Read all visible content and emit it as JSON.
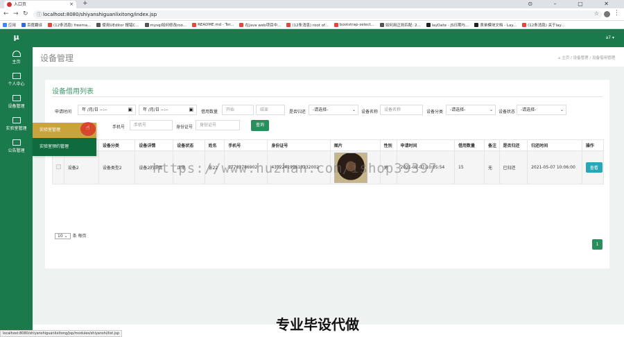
{
  "browser": {
    "tab_title": "入口页",
    "url": "localhost:8080/shiyanshiguanlixitong/index.jsp",
    "status_url": "localhost:8080/shiyanshiguanlixitong/jsp/modules/shiyanshi/list.jsp",
    "bookmarks": [
      {
        "label": "应用",
        "color": "#4285f4"
      },
      {
        "label": "百度翻译",
        "color": "#2e6be6"
      },
      {
        "label": "(12条消息) freema...",
        "color": "#e8453c"
      },
      {
        "label": "使用UEditor 报错C...",
        "color": "#555"
      },
      {
        "label": "mysql如何修改roo...",
        "color": "#555"
      },
      {
        "label": "README.md - Ter...",
        "color": "#e8453c"
      },
      {
        "label": "在java web项目中...",
        "color": "#e8453c"
      },
      {
        "label": "(12条消息) root of...",
        "color": "#e8453c"
      },
      {
        "label": "bootstrap-select...",
        "color": "#e8453c"
      },
      {
        "label": "如何用正则匹配: 2...",
        "color": "#555"
      },
      {
        "label": "layDate - JS日期与...",
        "color": "#222"
      },
      {
        "label": "表单模块文档 - Lay...",
        "color": "#222"
      },
      {
        "label": "(12条消息) 关于lay...",
        "color": "#e8453c"
      }
    ]
  },
  "sidebar": {
    "logo": "μ",
    "items": [
      {
        "label": "主页",
        "icon": "dashboard-icon"
      },
      {
        "label": "个人中心",
        "icon": "monitor-icon"
      },
      {
        "label": "设备管理",
        "icon": "monitor-icon"
      },
      {
        "label": "实验室管理",
        "icon": "monitor-icon"
      },
      {
        "label": "公告管理",
        "icon": "monitor-icon"
      }
    ]
  },
  "flyout": {
    "item1": "实验室管理",
    "item2": "实验室预约管理"
  },
  "topbar": {
    "user": "a7 ▾"
  },
  "page": {
    "title": "设备管理",
    "breadcrumb": "⌂ 主页 / 设备管理 / 设备借用管理"
  },
  "panel": {
    "title": "设备借用列表",
    "filters": {
      "apply_time_label": "申请时间",
      "date_placeholder": "年 /月/日 --:--",
      "borrow_count_label": "借用数量",
      "start_placeholder": "开始",
      "end_placeholder": "结束",
      "returned_label": "是否归还",
      "select_placeholder": "-请选择-",
      "device_name_label": "设备名称",
      "device_name_placeholder": "设备名称",
      "device_category_label": "设备分类",
      "device_status_label": "设备状态",
      "phone_label": "手机号",
      "phone_placeholder": "手机号",
      "idcard_label": "身份证号",
      "idcard_placeholder": "身份证号",
      "query_button": "查询"
    },
    "columns": [
      "",
      "设备名称",
      "设备分类",
      "设备详情",
      "设备状态",
      "姓名",
      "手机号",
      "身份证号",
      "图片",
      "性别",
      "申请时间",
      "借用数量",
      "备注",
      "是否归还",
      "归还时间",
      "操作"
    ],
    "rows": [
      {
        "device_name": "设备2",
        "category": "设备类型2",
        "detail": "设备2的详情",
        "status": "正常",
        "name": "张22",
        "phone": "17703786902",
        "idcard": "410224199610232002",
        "gender": "男",
        "apply_time": "2021-05-07 10:05:54",
        "count": "15",
        "remark": "无",
        "returned": "已归还",
        "return_time": "2021-05-07 10:06:00",
        "action": "查看"
      }
    ],
    "page_size": "10",
    "page_size_suffix": "条 每页",
    "current_page": "1"
  },
  "overlay": {
    "watermark": "https://www.huzhan.com/ishop39397",
    "caption": "专业毕设代做"
  }
}
